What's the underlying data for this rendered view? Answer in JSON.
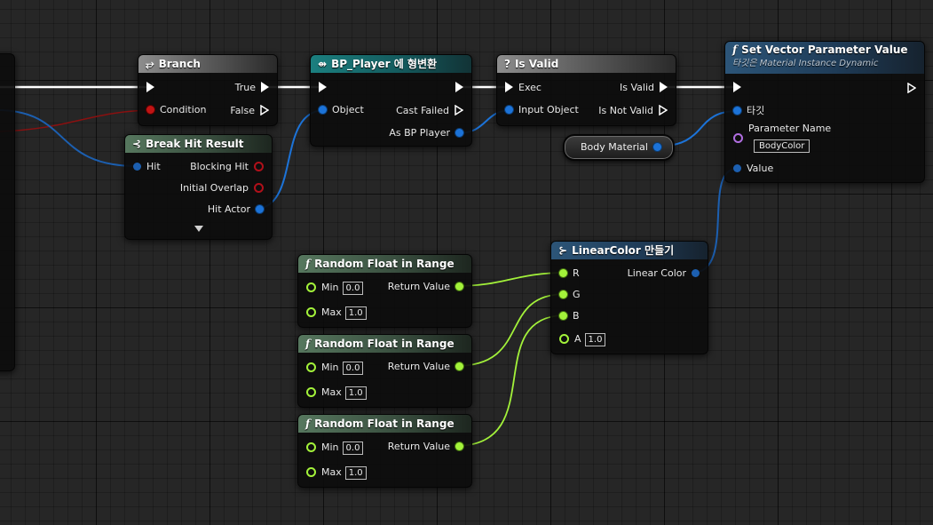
{
  "colors": {
    "exec": "#ffffff",
    "object_pin": "#1c73d8",
    "bool_pin": "#c01414",
    "float_pin": "#a3f23a",
    "name_pin": "#b06ee0"
  },
  "nodes": {
    "branch": {
      "icon": "branch-icon",
      "title": "Branch",
      "pins": {
        "true": "True",
        "condition": "Condition",
        "false": "False"
      }
    },
    "cast": {
      "icon": "cast-icon",
      "title": "BP_Player 에 형변환",
      "pins": {
        "object": "Object",
        "cast_failed": "Cast Failed",
        "as_bp_player": "As BP Player"
      }
    },
    "is_valid": {
      "icon": "question-icon",
      "title": "Is Valid",
      "pins": {
        "exec": "Exec",
        "is_valid": "Is Valid",
        "input_object": "Input Object",
        "is_not_valid": "Is Not Valid"
      }
    },
    "set_vector": {
      "icon": "function-icon",
      "title": "Set Vector Parameter Value",
      "subtitle": "타깃은 Material Instance Dynamic",
      "pins": {
        "target": "타깃",
        "parameter_name": "Parameter Name",
        "parameter_value": "BodyColor",
        "value": "Value"
      }
    },
    "break_hit": {
      "icon": "break-struct-icon",
      "title": "Break Hit Result",
      "pins": {
        "hit": "Hit",
        "blocking_hit": "Blocking Hit",
        "initial_overlap": "Initial Overlap",
        "hit_actor": "Hit Actor"
      }
    },
    "body_material": {
      "label": "Body Material"
    },
    "make_color": {
      "icon": "make-struct-icon",
      "title": "LinearColor 만들기",
      "pins": {
        "r": "R",
        "g": "G",
        "b": "B",
        "a": "A",
        "a_value": "1.0",
        "linear_color": "Linear Color"
      }
    },
    "random_floats": [
      {
        "icon": "function-icon",
        "title": "Random Float in Range",
        "min_label": "Min",
        "min": "0.0",
        "max_label": "Max",
        "max": "1.0",
        "return_label": "Return Value"
      },
      {
        "icon": "function-icon",
        "title": "Random Float in Range",
        "min_label": "Min",
        "min": "0.0",
        "max_label": "Max",
        "max": "1.0",
        "return_label": "Return Value"
      },
      {
        "icon": "function-icon",
        "title": "Random Float in Range",
        "min_label": "Min",
        "min": "0.0",
        "max_label": "Max",
        "max": "1.0",
        "return_label": "Return Value"
      }
    ]
  }
}
